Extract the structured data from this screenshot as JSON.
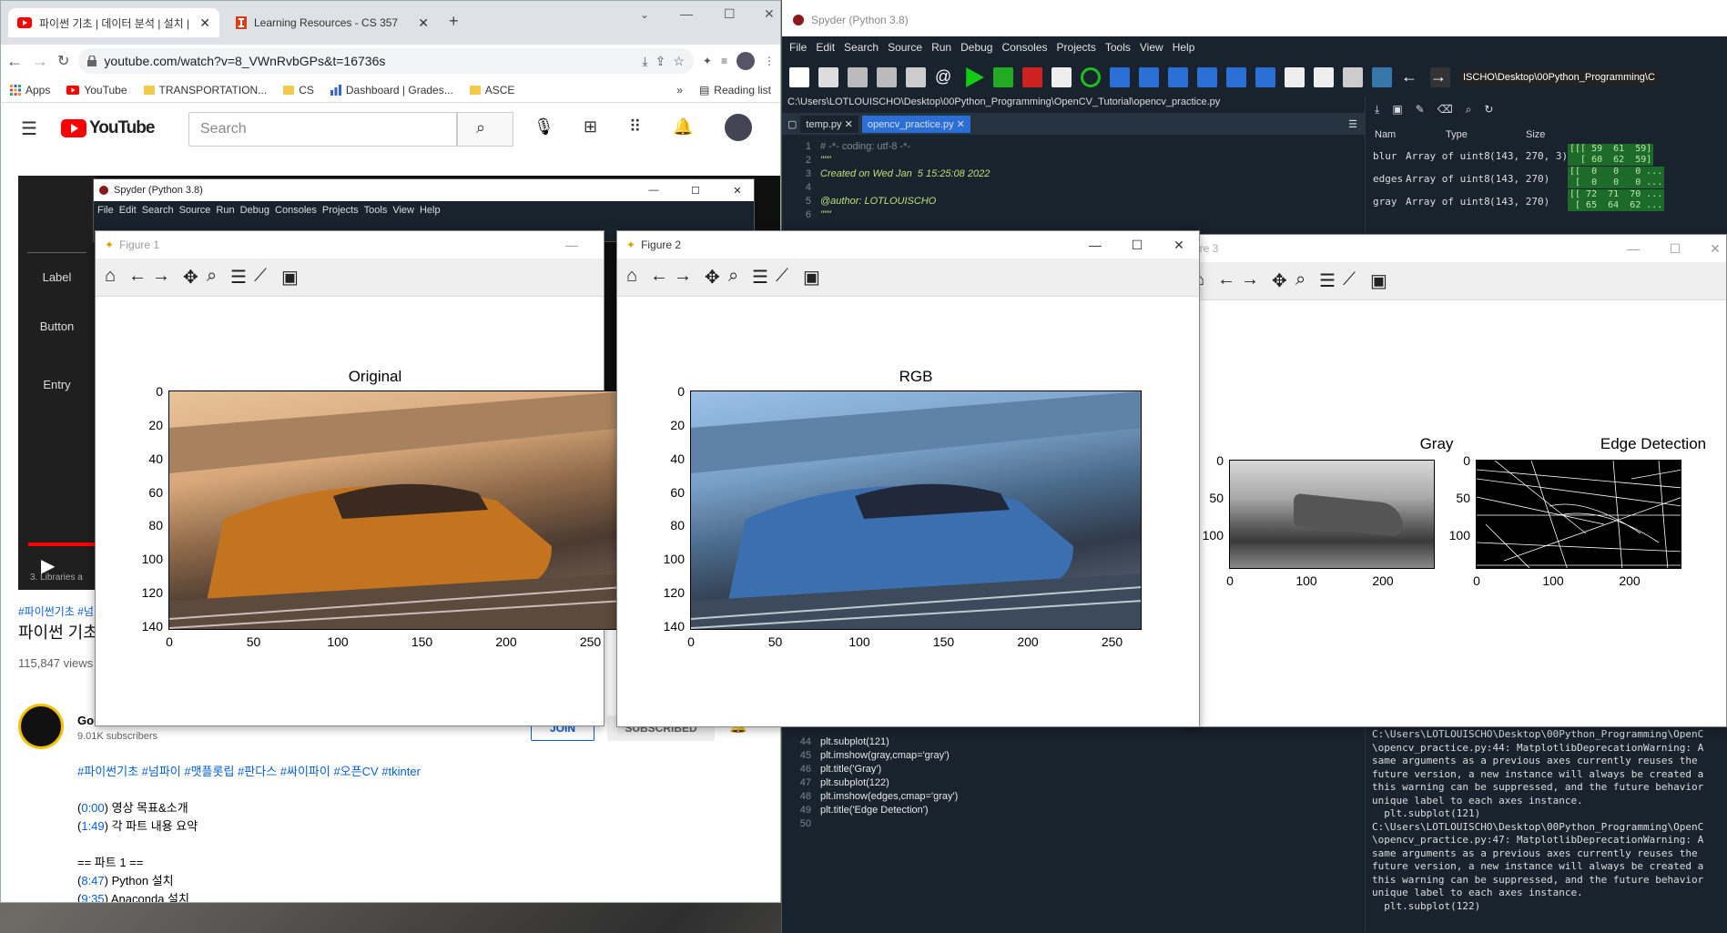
{
  "chrome": {
    "tabs": [
      {
        "title": "파이썬 기초 | 데이터 분석 | 설치 | ..."
      },
      {
        "title": "Learning Resources - CS 357"
      }
    ],
    "url": "youtube.com/watch?v=8_VWnRvbGPs&t=16736s",
    "bookmarks": [
      "Apps",
      "YouTube",
      "TRANSPORTATION...",
      "CS",
      "Dashboard | Grades...",
      "ASCE"
    ],
    "reading_list": "Reading list",
    "more_bookmarks": "»"
  },
  "youtube": {
    "logo": "YouTube",
    "search_placeholder": "Search",
    "side_labels": [
      "Label",
      "Button",
      "Entry"
    ],
    "hashtags_top": "#파이썬기초 #넘",
    "video_title": "파이썬 기초",
    "views": "115,847 views",
    "progress_label": "3. Libraries a",
    "channel_name": "Gor",
    "subscribers": "9.01K subscribers",
    "join_label": "JOIN",
    "subscribed_label": "SUBSCRIBED",
    "tags": "#파이썬기초 #넘파이 #맷플롯립 #판다스 #싸이파이 #오픈CV #tkinter",
    "chapters": [
      {
        "time": "0:00",
        "text": "영상 목표&소개"
      },
      {
        "time": "1:49",
        "text": "각 파트 내용 요약"
      }
    ],
    "part_header": "== 파트 1 ==",
    "part_items": [
      {
        "time": "8:47",
        "text": "Python 설치"
      },
      {
        "time": "9:35",
        "text": "Anaconda 설치"
      }
    ]
  },
  "spyder": {
    "title": "Spyder (Python 3.8)",
    "menu": [
      "File",
      "Edit",
      "Search",
      "Source",
      "Run",
      "Debug",
      "Consoles",
      "Projects",
      "Tools",
      "View",
      "Help"
    ],
    "toolbar_path": "ISCHO\\Desktop\\00Python_Programming\\C",
    "file_path": "C:\\Users\\LOTLOUISCHO\\Desktop\\00Python_Programming\\OpenCV_Tutorial\\opencv_practice.py",
    "tabs": [
      "temp.py",
      "opencv_practice.py"
    ],
    "code_top": [
      {
        "n": "1",
        "t": "# -*- coding: utf-8 -*-",
        "c": "cmt"
      },
      {
        "n": "2",
        "t": "\"\"\"",
        "c": "doc"
      },
      {
        "n": "3",
        "t": "Created on Wed Jan  5 15:25:08 2022",
        "c": "doc"
      },
      {
        "n": "4",
        "t": "",
        "c": "doc"
      },
      {
        "n": "5",
        "t": "@author: LOTLOUISCHO",
        "c": "doc"
      },
      {
        "n": "6",
        "t": "\"\"\"",
        "c": "doc"
      }
    ],
    "code_bottom": [
      {
        "n": "44",
        "t": "plt.subplot(121)"
      },
      {
        "n": "45",
        "t": "plt.imshow(gray,cmap='gray')"
      },
      {
        "n": "46",
        "t": "plt.title('Gray')"
      },
      {
        "n": "47",
        "t": "plt.subplot(122)"
      },
      {
        "n": "48",
        "t": "plt.imshow(edges,cmap='gray')"
      },
      {
        "n": "49",
        "t": "plt.title('Edge Detection')"
      },
      {
        "n": "50",
        "t": ""
      }
    ],
    "var_headers": [
      "Nam",
      "Type",
      "Size"
    ],
    "variables": [
      {
        "name": "blur",
        "type": "Array of uint8",
        "size": "(143, 270, 3)",
        "value": "[[[ 59  61  59]\n  [ 60  62  59]"
      },
      {
        "name": "edges",
        "type": "Array of uint8",
        "size": "(143, 270)",
        "value": "[[  0   0   0 ...\n [  0   0   0 ..."
      },
      {
        "name": "gray",
        "type": "Array of uint8",
        "size": "(143, 270)",
        "value": "[[ 72  71  70 ...\n [ 65  64  62 ..."
      }
    ],
    "console": "C:\\Users\\LOTLOUISCHO\\Desktop\\00Python_Programming\\OpenC\n\\opencv_practice.py:44: MatplotlibDeprecationWarning: A\nsame arguments as a previous axes currently reuses the\nfuture version, a new instance will always be created a\nthis warning can be suppressed, and the future behavior\nunique label to each axes instance.\n  plt.subplot(121)\nC:\\Users\\LOTLOUISCHO\\Desktop\\00Python_Programming\\OpenC\n\\opencv_practice.py:47: MatplotlibDeprecationWarning: A\nsame arguments as a previous axes currently reuses the\nfuture version, a new instance will always be created a\nthis warning can be suppressed, and the future behavior\nunique label to each axes instance.\n  plt.subplot(122)"
  },
  "spyder_small": {
    "title": "Spyder (Python 3.8)",
    "menu": [
      "File",
      "Edit",
      "Search",
      "Source",
      "Run",
      "Debug",
      "Consoles",
      "Projects",
      "Tools",
      "View",
      "Help"
    ]
  },
  "figures": [
    {
      "title": "Figure 1",
      "plot_title": "Original",
      "yticks": [
        "0",
        "20",
        "40",
        "60",
        "80",
        "100",
        "120",
        "140"
      ],
      "xticks": [
        "0",
        "50",
        "100",
        "150",
        "200",
        "250"
      ]
    },
    {
      "title": "Figure 2",
      "plot_title": "RGB",
      "yticks": [
        "0",
        "20",
        "40",
        "60",
        "80",
        "100",
        "120",
        "140"
      ],
      "xticks": [
        "0",
        "50",
        "100",
        "150",
        "200",
        "250"
      ]
    },
    {
      "title": "ure 3",
      "plots": [
        {
          "plot_title": "Gray",
          "yticks": [
            "0",
            "50",
            "100"
          ],
          "xticks": [
            "0",
            "100",
            "200"
          ]
        },
        {
          "plot_title": "Edge Detection",
          "yticks": [
            "0",
            "50",
            "100"
          ],
          "xticks": [
            "0",
            "100",
            "200"
          ]
        }
      ]
    }
  ],
  "colors": {
    "spyder_bg": "#19232d",
    "youtube_red": "#ff0000",
    "train_orange": "#c4741e",
    "train_blue": "#3c6fb0"
  }
}
